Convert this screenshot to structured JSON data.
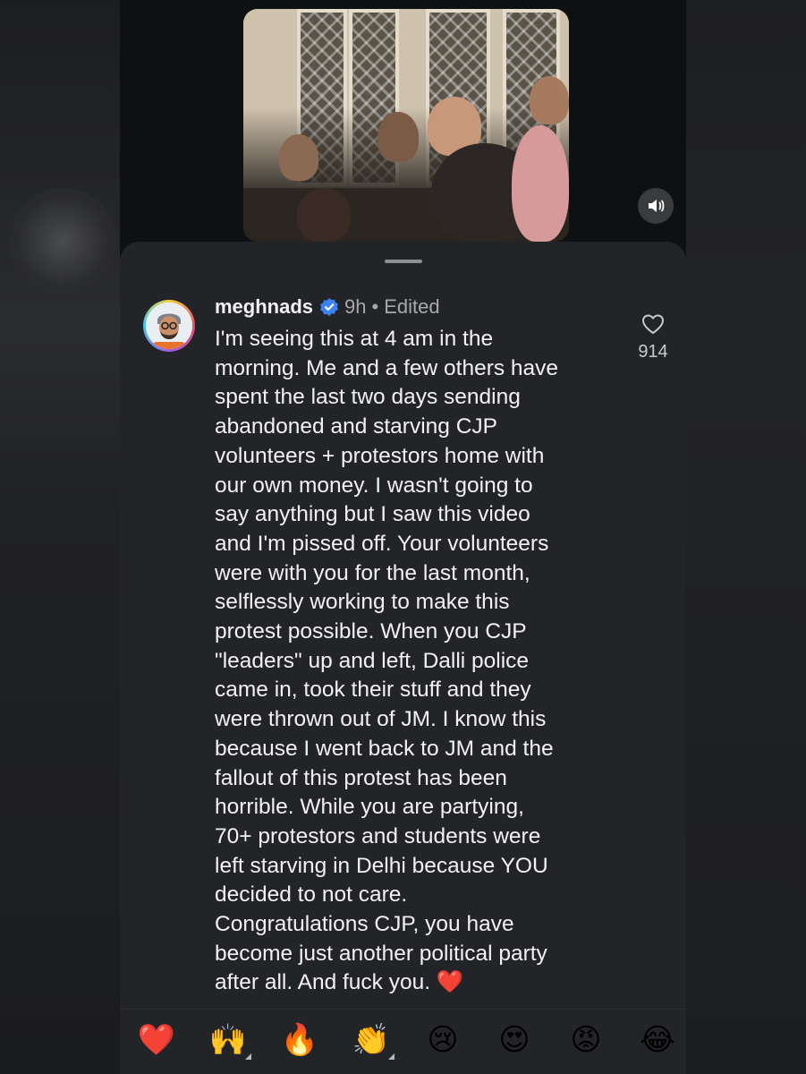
{
  "comment": {
    "username": "meghnads",
    "time": "9h",
    "edited": "Edited",
    "text": "I'm seeing this at 4 am in the\nmorning. Me and a few others have\nspent the last two days sending\nabandoned and starving CJP\nvolunteers + protestors home with\nour own money. I wasn't going to\nsay anything but I saw this video\nand I'm pissed off. Your volunteers\nwere with you for the last month,\nselflessly working to make this\nprotest possible. When you CJP\n\"leaders\" up and left, Dalli police\ncame in, took their stuff and they\nwere thrown out of JM. I know this\nbecause I went back to JM and the\nfallout of this protest has been\nhorrible. While you are partying,\n70+ protestors and students were\nleft starving in Delhi because YOU\ndecided to not care.\nCongratulations CJP, you have\nbecome just another political party\nafter all. And fuck you. ❤️",
    "likes": "914"
  },
  "icons": {
    "verified": "verified-badge-icon",
    "like": "heart-outline-icon",
    "mute": "speaker-icon"
  },
  "colors": {
    "verified_blue": "#3b82f6",
    "sheet_bg": "#232428",
    "heart_red": "#e0262a"
  },
  "reactions": [
    {
      "emoji": "❤️",
      "name": "red-heart"
    },
    {
      "emoji": "🙌",
      "name": "raising-hands"
    },
    {
      "emoji": "🔥",
      "name": "fire"
    },
    {
      "emoji": "👏",
      "name": "clapping-hands"
    },
    {
      "emoji": "😢",
      "name": "crying-face"
    },
    {
      "emoji": "😍",
      "name": "heart-eyes"
    },
    {
      "emoji": "😡",
      "name": "angry-face"
    },
    {
      "emoji": "😂",
      "name": "tears-of-joy"
    }
  ]
}
